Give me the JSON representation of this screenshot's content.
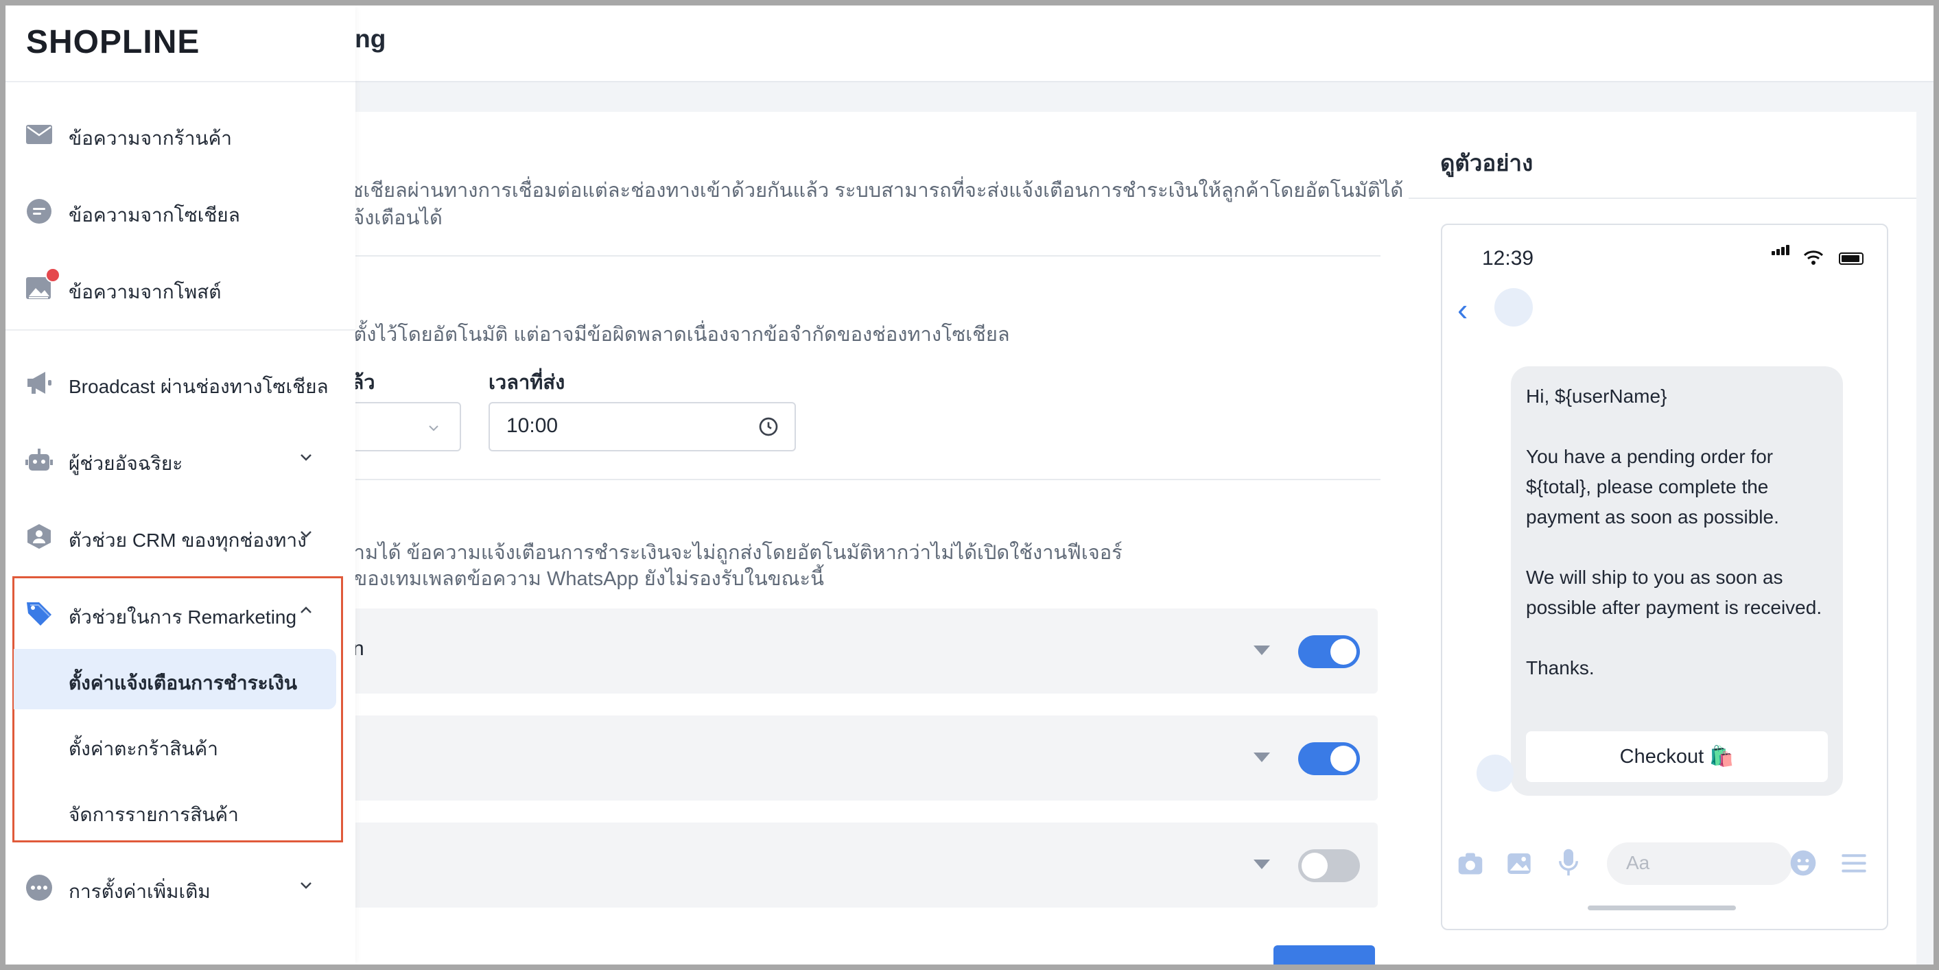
{
  "app": {
    "logo_text": "SHOPLINE",
    "page_title": "eting"
  },
  "sidebar": {
    "items": [
      {
        "label": "ข้อความจากร้านค้า",
        "icon": "mail-icon"
      },
      {
        "label": "ข้อความจากโซเชียล",
        "icon": "chat-icon"
      },
      {
        "label": "ข้อความจากโพสต์",
        "icon": "image-post-icon",
        "badge": true
      },
      {
        "label": "Broadcast ผ่านช่องทางโซเชียล",
        "icon": "megaphone-icon"
      },
      {
        "label": "ผู้ช่วยอัจฉริยะ",
        "icon": "robot-icon",
        "expandable": true
      },
      {
        "label": "ตัวช่วย CRM ของทุกช่องทาง",
        "icon": "crm-icon",
        "expandable": true
      },
      {
        "label": "ตัวช่วยในการ Remarketing",
        "icon": "tag-icon",
        "expanded": true
      },
      {
        "label": "การตั้งค่าเพิ่มเติม",
        "icon": "more-icon",
        "expandable": true
      }
    ],
    "remarketing_sub": [
      {
        "label": "ตั้งค่าแจ้งเตือนการชำระเงิน",
        "active": true
      },
      {
        "label": "ตั้งค่าตะกร้าสินค้า"
      },
      {
        "label": "จัดการรายการสินค้า"
      }
    ]
  },
  "main": {
    "desc1_line1": "งโซเชียลผ่านทางการเชื่อมต่อแต่ละช่องทางเข้าด้วยกันแล้ว ระบบสามารถที่จะส่งแจ้งเตือนการชำระเงินให้ลูกค้าโดยอัตโนมัติได้ โดย",
    "desc1_line2": "รแจ้งเตือนได้",
    "desc2": "าที่ตั้งไว้โดยอัตโนมัติ แต่อาจมีข้อผิดพลาดเนื่องจากข้อจำกัดของช่องทางโซเชียล",
    "field1_label": "นแล้ว",
    "field2_label": "เวลาที่ส่ง",
    "time_value": "10:00",
    "desc3_line1": "ความได้ ข้อความแจ้งเตือนการชำระเงินจะไม่ถูกส่งโดยอัตโนมัติหากว่าไม่ได้เปิดใช้งานฟีเจอร์",
    "desc3_line2": "หาของเทมเพลตข้อความ WhatsApp ยังไม่รองรับในขณะนี้",
    "channels": [
      {
        "label": "n",
        "enabled": true
      },
      {
        "label": "",
        "enabled": true
      },
      {
        "label": "",
        "enabled": false
      }
    ]
  },
  "preview": {
    "title": "ดูตัวอย่าง",
    "phone_time": "12:39",
    "message": {
      "line1": "Hi, ${userName}",
      "line2": "You have a pending order for ${total}, please complete the payment as soon as possible.",
      "line3": "We will ship to you as soon as possible after payment is received.",
      "line4": "Thanks."
    },
    "checkout_label": "Checkout 🛍️",
    "input_placeholder": "Aa"
  },
  "colors": {
    "accent": "#3a7be6",
    "highlight_border": "#e05a3a",
    "active_bg": "#e5eefc",
    "badge": "#e5484d"
  }
}
